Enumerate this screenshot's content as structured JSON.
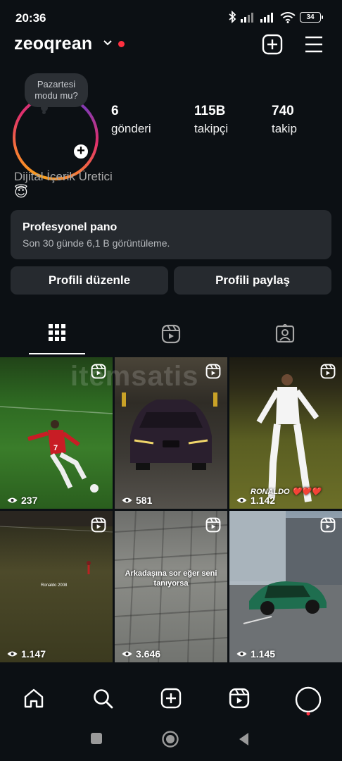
{
  "status_bar": {
    "time": "20:36",
    "battery": "34"
  },
  "header": {
    "username": "zeoqrean"
  },
  "profile": {
    "note": "Pazartesi modu mu?",
    "stats": [
      {
        "value": "6",
        "label": "gönderi"
      },
      {
        "value": "115B",
        "label": "takipçi"
      },
      {
        "value": "740",
        "label": "takip"
      }
    ],
    "category": "Dijital İçerik Üretici",
    "emoji": "😇"
  },
  "pro_dashboard": {
    "title": "Profesyonel pano",
    "subtitle": "Son 30 günde 6,1 B görüntüleme."
  },
  "buttons": {
    "edit": "Profili düzenle",
    "share": "Profili paylaş"
  },
  "tabs": [
    "posts-grid",
    "reels",
    "tagged"
  ],
  "grid": [
    {
      "views": "237",
      "type": "reel"
    },
    {
      "views": "581",
      "type": "reel"
    },
    {
      "views": "1.142",
      "type": "reel",
      "caption": "RONALDO ❤️❤️❤️"
    },
    {
      "views": "1.147",
      "type": "reel",
      "small_text": "Ronaldo 2008"
    },
    {
      "views": "3.646",
      "type": "reel",
      "caption": "Arkadaşına sor eğer seni tanıyorsa"
    },
    {
      "views": "1.145",
      "type": "reel"
    }
  ],
  "watermark": "itemsatis",
  "colors": {
    "background": "#0c1014",
    "surface": "#262a2f",
    "live_dot": "#ff3040"
  }
}
